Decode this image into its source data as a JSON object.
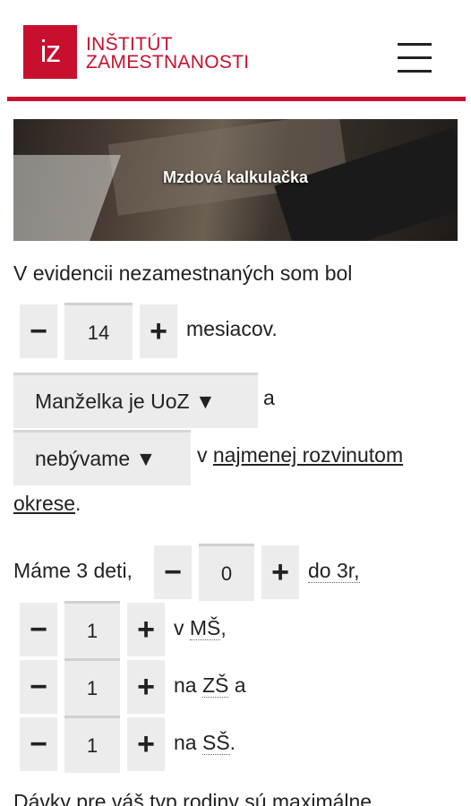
{
  "header": {
    "logo_mark": "iz",
    "logo_line1": "INŠTITÚT",
    "logo_line2": "ZAMESTNANOSTI",
    "menu_icon": "hamburger-icon"
  },
  "banner": {
    "title": "Mzdová kalkulačka"
  },
  "form": {
    "intro": "V evidencii nezamestnaných som bol",
    "months": {
      "minus": "−",
      "value": "14",
      "plus": "+",
      "suffix": "mesiacov."
    },
    "spouse_select": "Manželka je UoZ ▼",
    "and_word": "a",
    "district_select": "nebývame ▼",
    "district_prefix": "v",
    "district_link_1": "najmenej rozvinutom",
    "district_link_2": "okrese",
    "district_end": ".",
    "kids_intro": "Máme 3 deti,",
    "kids_under3": {
      "minus": "−",
      "value": "0",
      "plus": "+",
      "suffix": "do 3r,"
    },
    "kids_ms": {
      "minus": "−",
      "value": "1",
      "plus": "+",
      "prefix": "v",
      "abbr": "MŠ",
      "end": ","
    },
    "kids_zs": {
      "minus": "−",
      "value": "1",
      "plus": "+",
      "prefix": "na",
      "abbr": "ZŠ",
      "end": "a"
    },
    "kids_ss": {
      "minus": "−",
      "value": "1",
      "plus": "+",
      "prefix": "na",
      "abbr": "SŠ",
      "end": "."
    },
    "footer_text": "Dávky pre váš typ rodiny sú maximálne"
  }
}
